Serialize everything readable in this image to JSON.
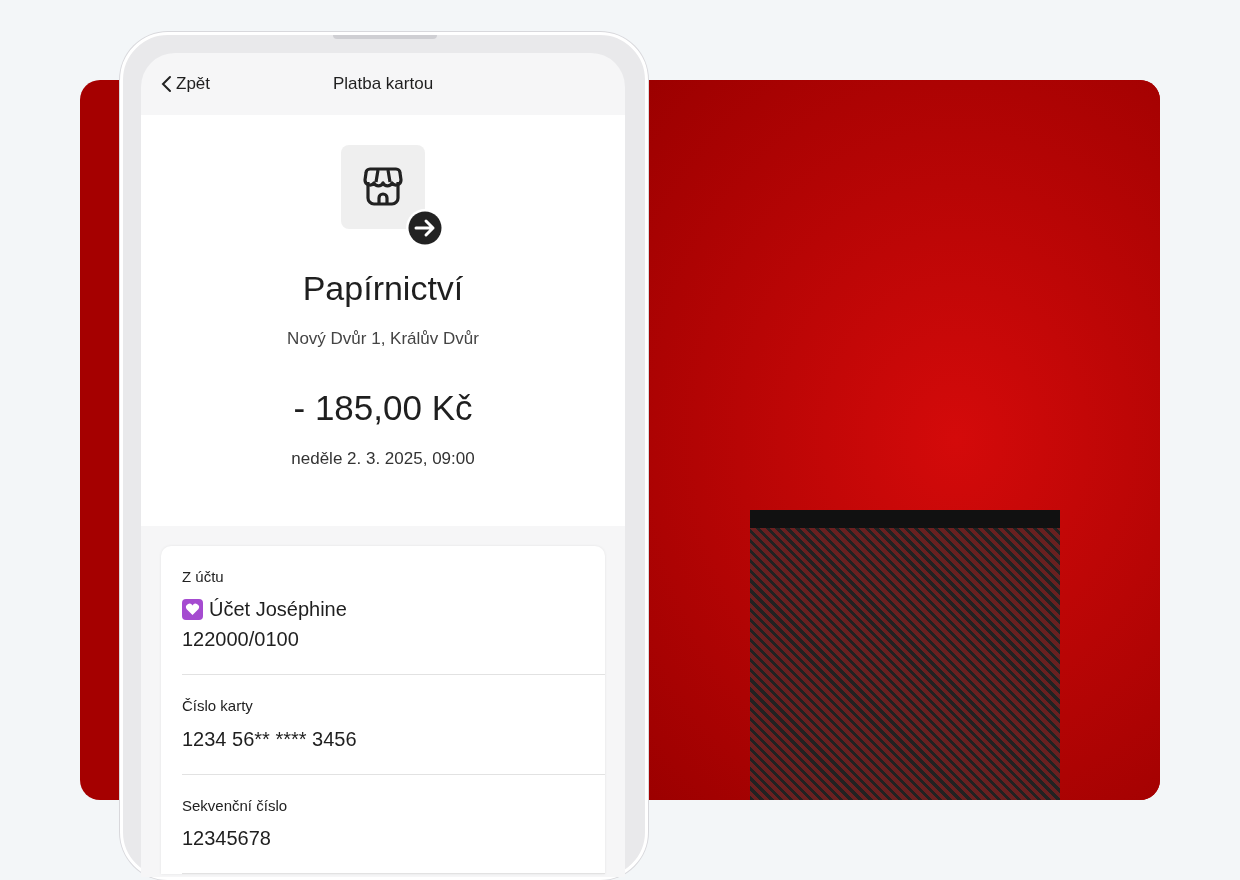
{
  "header": {
    "back": "Zpět",
    "title": "Platba kartou"
  },
  "merchant": {
    "name": "Papírnictví",
    "address": "Nový Dvůr 1, Králův Dvůr",
    "amount": "- 185,00 Kč",
    "date": "neděle 2. 3. 2025, 09:00"
  },
  "details": [
    {
      "kind": "account",
      "label": "Z účtu",
      "values": [
        "Účet Joséphine",
        "122000/0100"
      ]
    },
    {
      "kind": "plain",
      "label": "Číslo karty",
      "values": [
        "1234 56** **** 3456"
      ]
    },
    {
      "kind": "plain",
      "label": "Sekvenční číslo",
      "values": [
        "12345678"
      ]
    }
  ]
}
